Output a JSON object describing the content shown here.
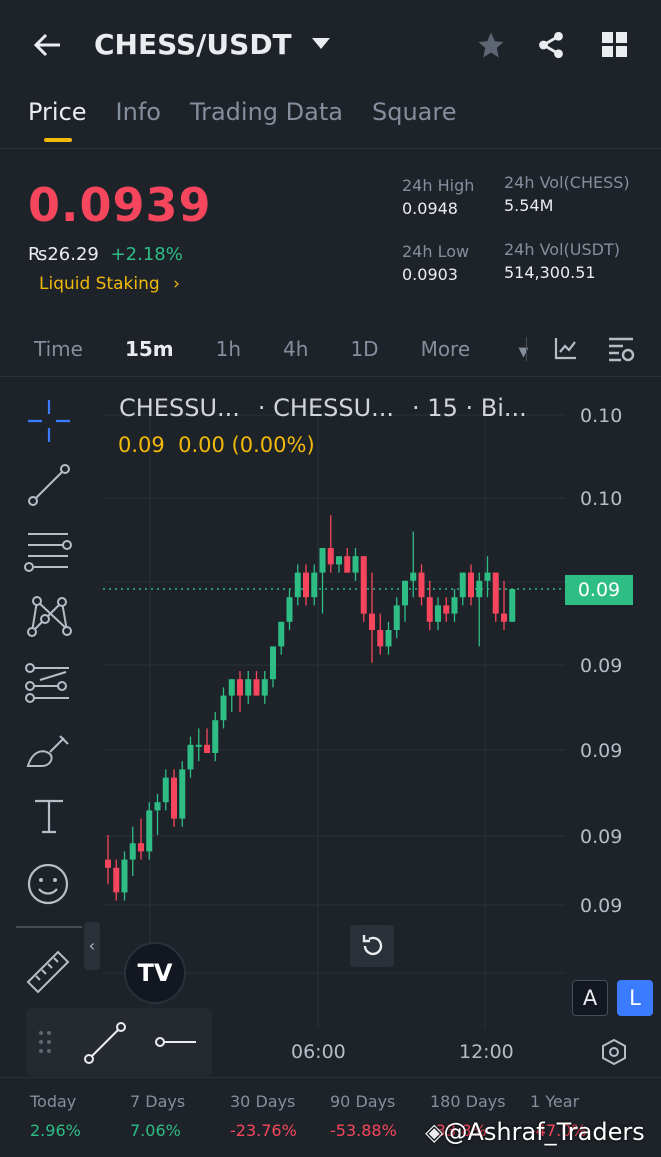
{
  "header": {
    "title": "CHESS/USDT",
    "back_icon": "arrow-left-icon",
    "star_icon": "star-icon",
    "share_icon": "share-icon",
    "grid_icon": "grid-icon"
  },
  "tabs": [
    "Price",
    "Info",
    "Trading Data",
    "Square"
  ],
  "ticker": {
    "price": "0.0939",
    "fiat": "₨26.29",
    "change": "+2.18%",
    "tag": "Liquid Staking",
    "tag_arrow": "›"
  },
  "stats": {
    "high_label": "24h High",
    "high": "0.0948",
    "low_label": "24h Low",
    "low": "0.0903",
    "vol_base_label": "24h Vol(CHESS)",
    "vol_base": "5.54M",
    "vol_quote_label": "24h Vol(USDT)",
    "vol_quote": "514,300.51"
  },
  "timeframes": [
    "Time",
    "15m",
    "1h",
    "4h",
    "1D",
    "More"
  ],
  "chart_header": {
    "sym1": "CHESSU...",
    "sym2": "· CHESSU...",
    "interval": "· 15 · Bi...",
    "ohlc": "0.09  0.00 (0.00%)"
  },
  "last_price_tag": "0.09",
  "a_label": "A",
  "l_label": "L",
  "colors": {
    "up": "#2ebd85",
    "down": "#f6465d",
    "accent": "#f0b90b",
    "bg": "#1e2329"
  },
  "chart_data": {
    "type": "candlestick",
    "title": "CHESS/USDT 15m",
    "yticks": [
      "0.10",
      "0.10",
      "0.09",
      "0.09",
      "0.09",
      "0.09",
      "0.09"
    ],
    "xticks": [
      "06:00",
      "12:00"
    ],
    "last": 0.0939,
    "candles": [
      [
        0.0906,
        0.0909,
        0.0903,
        0.0905
      ],
      [
        0.0905,
        0.0906,
        0.0901,
        0.0902
      ],
      [
        0.0902,
        0.0907,
        0.0901,
        0.0906
      ],
      [
        0.0906,
        0.091,
        0.0904,
        0.0908
      ],
      [
        0.0908,
        0.0911,
        0.0906,
        0.0907
      ],
      [
        0.0907,
        0.0913,
        0.0906,
        0.0912
      ],
      [
        0.0912,
        0.0914,
        0.0909,
        0.0913
      ],
      [
        0.0913,
        0.0917,
        0.0912,
        0.0916
      ],
      [
        0.0916,
        0.0917,
        0.091,
        0.0911
      ],
      [
        0.0911,
        0.0918,
        0.091,
        0.0917
      ],
      [
        0.0917,
        0.0921,
        0.0916,
        0.092
      ],
      [
        0.092,
        0.0922,
        0.0918,
        0.092
      ],
      [
        0.092,
        0.0922,
        0.0919,
        0.0919
      ],
      [
        0.0919,
        0.0924,
        0.0918,
        0.0923
      ],
      [
        0.0923,
        0.0927,
        0.0922,
        0.0926
      ],
      [
        0.0926,
        0.0928,
        0.0924,
        0.0928
      ],
      [
        0.0928,
        0.0929,
        0.0924,
        0.0926
      ],
      [
        0.0926,
        0.0929,
        0.0925,
        0.0928
      ],
      [
        0.0928,
        0.0929,
        0.0926,
        0.0926
      ],
      [
        0.0926,
        0.0929,
        0.0925,
        0.0928
      ],
      [
        0.0928,
        0.0932,
        0.0927,
        0.0932
      ],
      [
        0.0932,
        0.0935,
        0.0931,
        0.0935
      ],
      [
        0.0935,
        0.0939,
        0.0934,
        0.0938
      ],
      [
        0.0938,
        0.0942,
        0.0937,
        0.0941
      ],
      [
        0.0941,
        0.0942,
        0.0937,
        0.0938
      ],
      [
        0.0938,
        0.0942,
        0.0937,
        0.0941
      ],
      [
        0.0941,
        0.0944,
        0.0936,
        0.0944
      ],
      [
        0.0944,
        0.0948,
        0.0941,
        0.0942
      ],
      [
        0.0942,
        0.0943,
        0.0941,
        0.0943
      ],
      [
        0.0943,
        0.0944,
        0.0941,
        0.0941
      ],
      [
        0.0941,
        0.0944,
        0.094,
        0.0943
      ],
      [
        0.0943,
        0.0943,
        0.0935,
        0.0936
      ],
      [
        0.0936,
        0.0941,
        0.093,
        0.0934
      ],
      [
        0.0934,
        0.0936,
        0.0931,
        0.0932
      ],
      [
        0.0932,
        0.0935,
        0.0931,
        0.0934
      ],
      [
        0.0934,
        0.0938,
        0.0933,
        0.0937
      ],
      [
        0.0937,
        0.094,
        0.0935,
        0.094
      ],
      [
        0.094,
        0.0946,
        0.0938,
        0.0941
      ],
      [
        0.0941,
        0.0942,
        0.0937,
        0.0938
      ],
      [
        0.0938,
        0.094,
        0.0934,
        0.0935
      ],
      [
        0.0935,
        0.0938,
        0.0934,
        0.0937
      ],
      [
        0.0937,
        0.0938,
        0.0935,
        0.0936
      ],
      [
        0.0936,
        0.0939,
        0.0935,
        0.0938
      ],
      [
        0.0938,
        0.0941,
        0.0937,
        0.0941
      ],
      [
        0.0941,
        0.0942,
        0.0937,
        0.0938
      ],
      [
        0.0938,
        0.0941,
        0.0932,
        0.094
      ],
      [
        0.094,
        0.0943,
        0.0938,
        0.0941
      ],
      [
        0.0941,
        0.0941,
        0.0935,
        0.0936
      ],
      [
        0.0936,
        0.094,
        0.0934,
        0.0935
      ],
      [
        0.0935,
        0.0939,
        0.0935,
        0.0939
      ]
    ]
  },
  "performance": [
    {
      "label": "Today",
      "value": "2.96%",
      "dir": "up"
    },
    {
      "label": "7 Days",
      "value": "7.06%",
      "dir": "up"
    },
    {
      "label": "30 Days",
      "value": "-23.76%",
      "dir": "down"
    },
    {
      "label": "90 Days",
      "value": "-53.88%",
      "dir": "down"
    },
    {
      "label": "180 Days",
      "value": "-33.8%",
      "dir": "down"
    },
    {
      "label": "1 Year",
      "value": "-47.0%",
      "dir": "down"
    }
  ],
  "watermark": "@Ashraf_Traders"
}
